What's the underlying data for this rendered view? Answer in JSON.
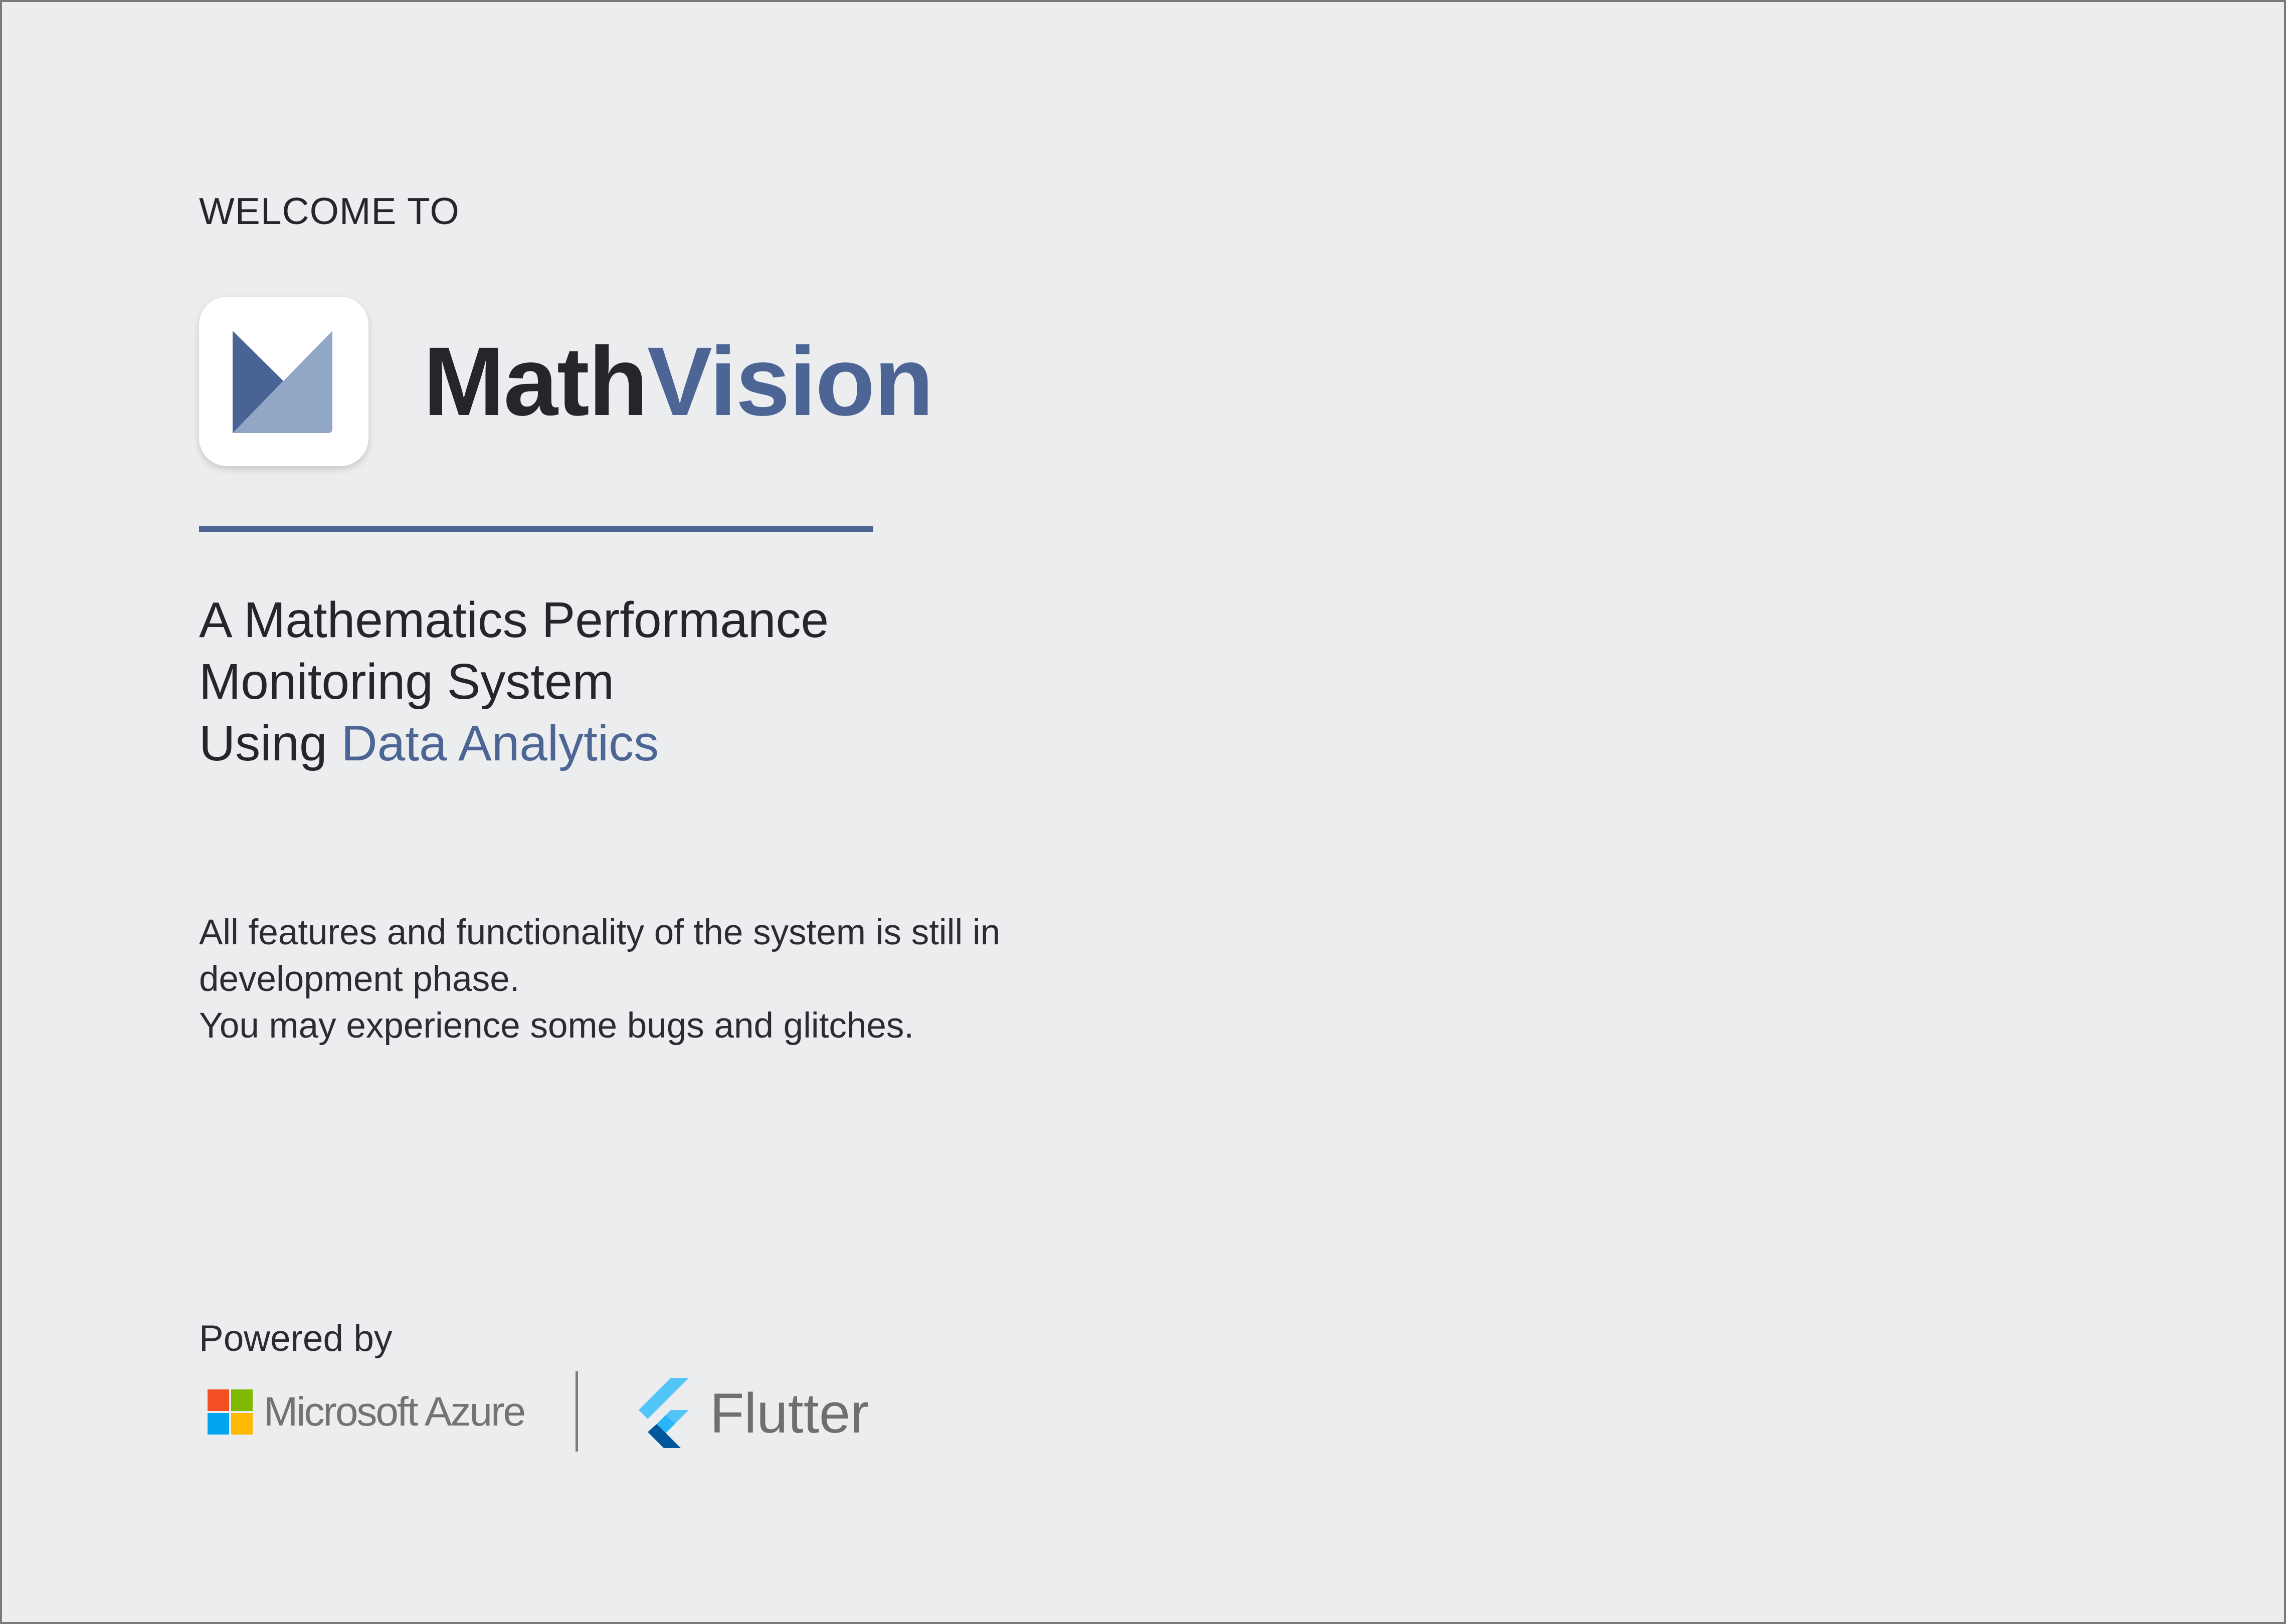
{
  "welcome_label": "WELCOME TO",
  "brand": {
    "name_part1": "Math",
    "name_part2": "Vision",
    "logo_icon": "mathvision-logo-icon",
    "accent_color": "#4c6594"
  },
  "tagline": {
    "line1": "A Mathematics Performance",
    "line2": "Monitoring System",
    "line3_prefix": "Using",
    "line3_accent": "Data Analytics"
  },
  "notice": {
    "line1": "All features and functionality of the system is still in",
    "line2": "development phase.",
    "line3": "You may experience some bugs and glitches."
  },
  "powered_by": {
    "label": "Powered by",
    "providers": [
      {
        "name": "Microsoft Azure",
        "icon": "microsoft-logo-icon"
      },
      {
        "name": "Flutter",
        "icon": "flutter-logo-icon"
      }
    ]
  }
}
